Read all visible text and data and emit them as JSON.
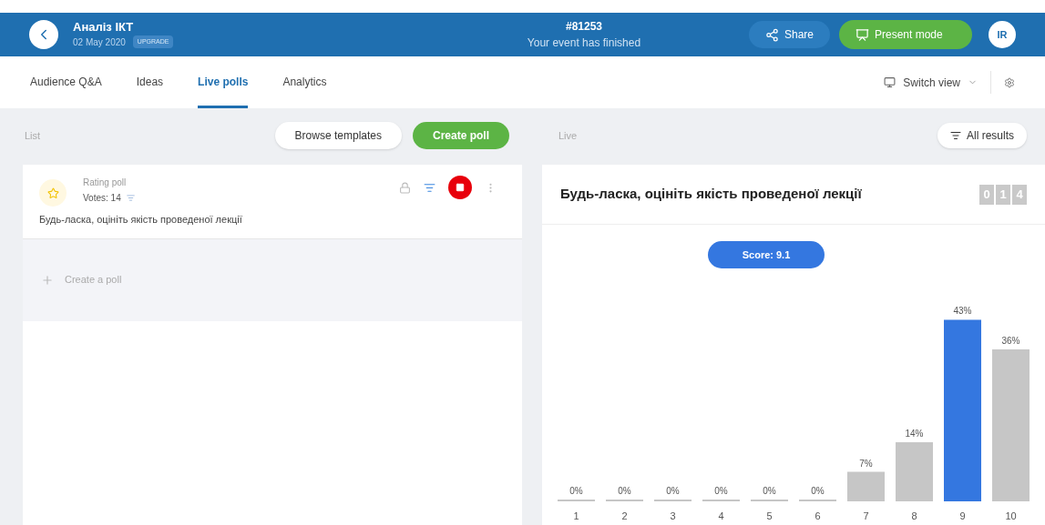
{
  "header": {
    "title": "Аналіз ІКТ",
    "date": "02 May 2020",
    "badge": "UPGRADE",
    "event_code": "#81253",
    "event_status": "Your event has finished",
    "share": "Share",
    "present": "Present mode",
    "avatar": "IR"
  },
  "tabs": [
    {
      "label": "Audience Q&A",
      "selected": false
    },
    {
      "label": "Ideas",
      "selected": false
    },
    {
      "label": "Live polls",
      "selected": true
    },
    {
      "label": "Analytics",
      "selected": false
    }
  ],
  "switch_view": "Switch view",
  "list": {
    "label": "List",
    "browse": "Browse templates",
    "create": "Create poll",
    "polls": [
      {
        "type": "Rating poll",
        "votes": "Votes: 14",
        "question": "Будь-ласка, оцініть якість проведеної лекції"
      }
    ],
    "create_placeholder": "Create a poll"
  },
  "live": {
    "label": "Live",
    "all_results": "All results",
    "question": "Будь-ласка, оцініть якість проведеної лекції",
    "counter": [
      "0",
      "1",
      "4"
    ],
    "score": "Score: 9.1",
    "chart_data": {
      "type": "bar",
      "categories": [
        "1",
        "2",
        "3",
        "4",
        "5",
        "6",
        "7",
        "8",
        "9",
        "10"
      ],
      "series": [
        {
          "color": "#c6c6c6",
          "values": [
            0,
            0,
            0,
            0,
            0,
            0,
            7,
            14,
            null,
            36
          ],
          "value_labels": [
            "0%",
            "0%",
            "0%",
            "0%",
            "0%",
            "0%",
            "7%",
            "14%",
            null,
            "36%"
          ]
        },
        {
          "color": "#3477e0",
          "values": [
            null,
            null,
            null,
            null,
            null,
            null,
            null,
            null,
            43,
            null
          ],
          "value_labels": [
            null,
            null,
            null,
            null,
            null,
            null,
            null,
            null,
            "43%",
            null
          ]
        }
      ],
      "data_labels": true
    }
  }
}
